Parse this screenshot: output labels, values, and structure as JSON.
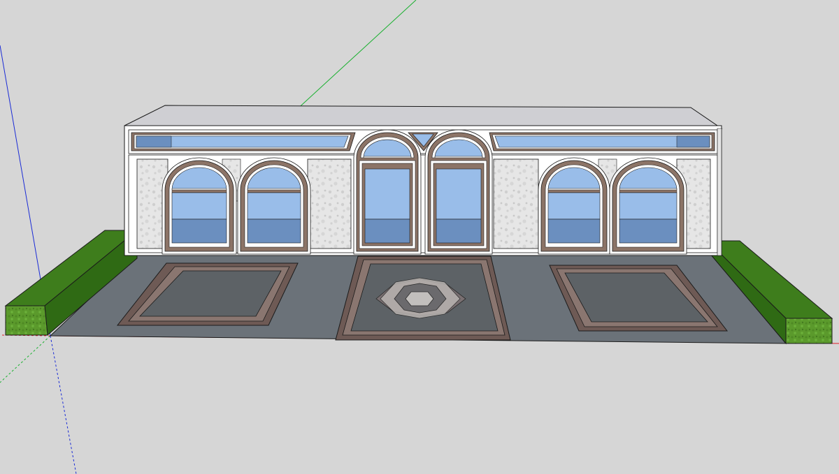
{
  "viewport": {
    "background": "#d6d6d6"
  },
  "axes": {
    "x_color": "#e0202a",
    "y_color": "#19b02f",
    "z_color": "#1a2bd6"
  },
  "model": {
    "name": "",
    "materials": {
      "roof": "#cfcfd3",
      "roof_edge": "#bdbdc2",
      "trim_white": "#ffffff",
      "marble": "#e6e6e6",
      "marble_vein": "#c9c9c9",
      "frame_brown": "#8c7467",
      "frame_dark": "#5b4a41",
      "glass_light": "#99bde9",
      "glass_mid": "#7ea3d2",
      "glass_dark": "#6b8fbf",
      "floor": "#6b7279",
      "floor_tile_border": "#7a6560",
      "floor_tile_inner": "#5d6266",
      "floor_tile_light": "#b9b4b1",
      "hedge_top": "#4c8a22",
      "hedge_side": "#3f7a1b",
      "hedge_front": "#5b9a2c",
      "outline": "#1b1b1b"
    },
    "arched_windows": [
      {
        "id": "left-1"
      },
      {
        "id": "left-2"
      },
      {
        "id": "right-1"
      },
      {
        "id": "right-2"
      }
    ],
    "center_doors": [
      {
        "id": "center-left"
      },
      {
        "id": "center-right"
      }
    ],
    "floor_tiles": [
      {
        "id": "left"
      },
      {
        "id": "center"
      },
      {
        "id": "right"
      }
    ],
    "hedges": [
      {
        "id": "left"
      },
      {
        "id": "right"
      }
    ]
  }
}
